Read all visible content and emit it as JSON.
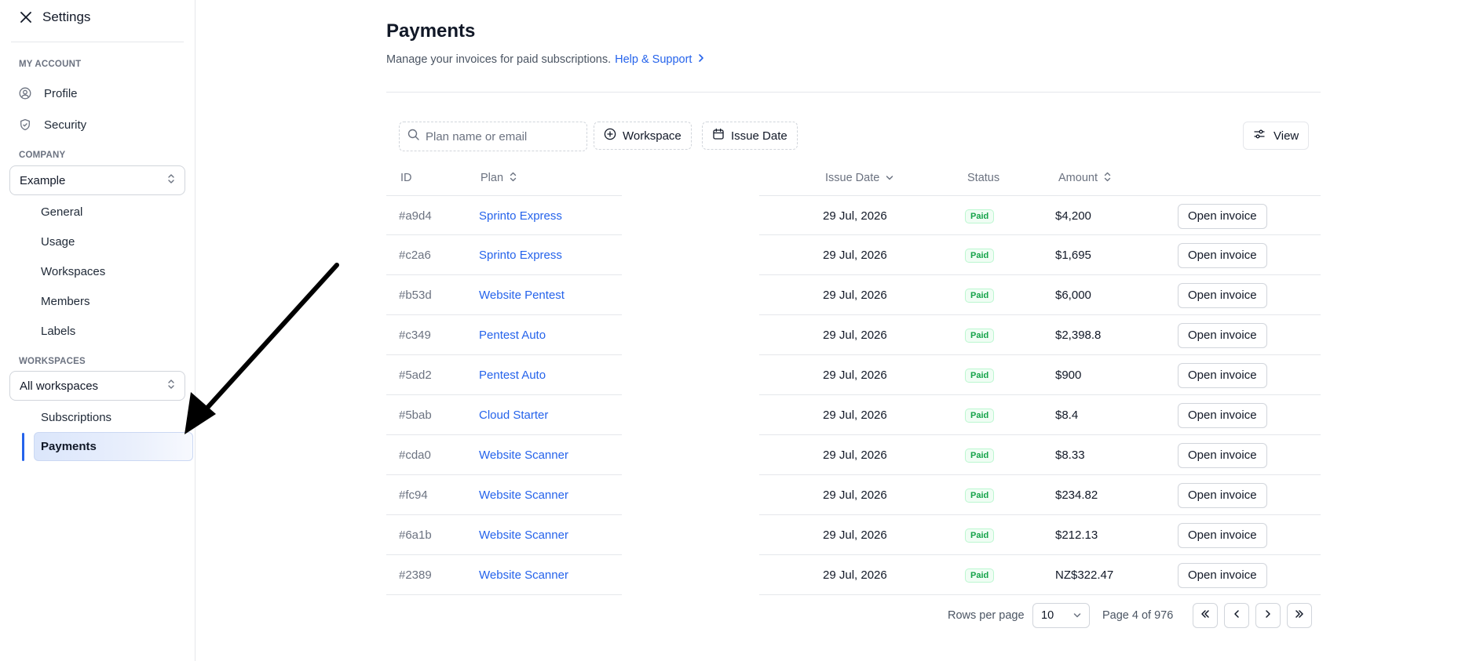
{
  "sidebar": {
    "title": "Settings",
    "my_account_heading": "MY ACCOUNT",
    "my_account_items": [
      {
        "label": "Profile",
        "icon": "user-circle-icon"
      },
      {
        "label": "Security",
        "icon": "shield-icon"
      }
    ],
    "company_heading": "COMPANY",
    "company_select": "Example",
    "company_items": [
      "General",
      "Usage",
      "Workspaces",
      "Members",
      "Labels"
    ],
    "workspaces_heading": "WORKSPACES",
    "workspaces_select": "All workspaces",
    "workspace_items": [
      "Subscriptions",
      "Payments"
    ],
    "active_item": "Payments"
  },
  "header": {
    "title": "Payments",
    "subtitle": "Manage your invoices for paid subscriptions.",
    "help_link": "Help & Support"
  },
  "toolbar": {
    "search_placeholder": "Plan name or email",
    "workspace_filter": "Workspace",
    "issue_date_filter": "Issue Date",
    "view_button": "View"
  },
  "table": {
    "columns": {
      "id": "ID",
      "plan": "Plan",
      "issue_date": "Issue Date",
      "status": "Status",
      "amount": "Amount"
    },
    "rows": [
      {
        "id": "#a9d4",
        "plan": "Sprinto Express",
        "date": "29 Jul, 2026",
        "status": "Paid",
        "amount": "$4,200",
        "action": "Open invoice"
      },
      {
        "id": "#c2a6",
        "plan": "Sprinto Express",
        "date": "29 Jul, 2026",
        "status": "Paid",
        "amount": "$1,695",
        "action": "Open invoice"
      },
      {
        "id": "#b53d",
        "plan": "Website Pentest",
        "date": "29 Jul, 2026",
        "status": "Paid",
        "amount": "$6,000",
        "action": "Open invoice"
      },
      {
        "id": "#c349",
        "plan": "Pentest Auto",
        "date": "29 Jul, 2026",
        "status": "Paid",
        "amount": "$2,398.8",
        "action": "Open invoice"
      },
      {
        "id": "#5ad2",
        "plan": "Pentest Auto",
        "date": "29 Jul, 2026",
        "status": "Paid",
        "amount": "$900",
        "action": "Open invoice"
      },
      {
        "id": "#5bab",
        "plan": "Cloud Starter",
        "date": "29 Jul, 2026",
        "status": "Paid",
        "amount": "$8.4",
        "action": "Open invoice"
      },
      {
        "id": "#cda0",
        "plan": "Website Scanner",
        "date": "29 Jul, 2026",
        "status": "Paid",
        "amount": "$8.33",
        "action": "Open invoice"
      },
      {
        "id": "#fc94",
        "plan": "Website Scanner",
        "date": "29 Jul, 2026",
        "status": "Paid",
        "amount": "$234.82",
        "action": "Open invoice"
      },
      {
        "id": "#6a1b",
        "plan": "Website Scanner",
        "date": "29 Jul, 2026",
        "status": "Paid",
        "amount": "$212.13",
        "action": "Open invoice"
      },
      {
        "id": "#2389",
        "plan": "Website Scanner",
        "date": "29 Jul, 2026",
        "status": "Paid",
        "amount": "NZ$322.47",
        "action": "Open invoice"
      }
    ]
  },
  "pagination": {
    "rows_per_page_label": "Rows per page",
    "rows_per_page": "10",
    "page_info": "Page 4 of 976"
  },
  "colors": {
    "accent": "#2563eb",
    "paid_badge": "#16a34a"
  }
}
